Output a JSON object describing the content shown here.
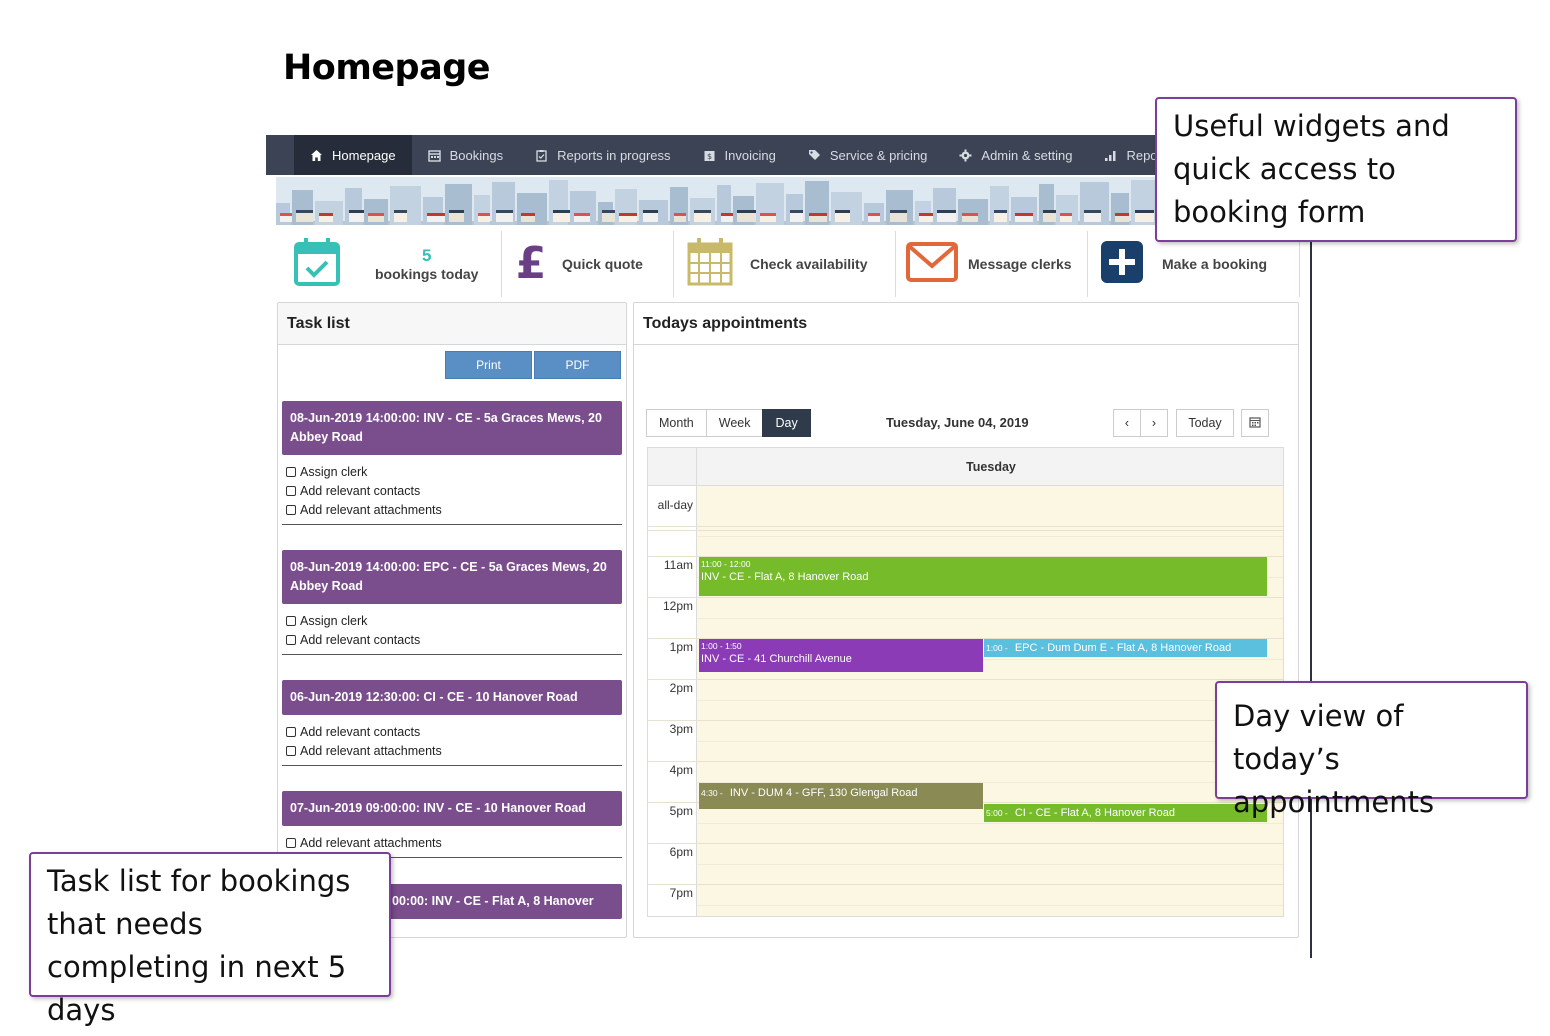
{
  "slide_title": "Homepage",
  "nav": {
    "items": [
      {
        "label": "Homepage",
        "icon": "home-icon",
        "active": true
      },
      {
        "label": "Bookings",
        "icon": "calendar-icon"
      },
      {
        "label": "Reports in progress",
        "icon": "clipboard-icon"
      },
      {
        "label": "Invoicing",
        "icon": "invoice-icon"
      },
      {
        "label": "Service & pricing",
        "icon": "tag-icon"
      },
      {
        "label": "Admin & setting",
        "icon": "gear-icon"
      },
      {
        "label": "Repo",
        "icon": "bar-chart-icon"
      }
    ]
  },
  "widgets": {
    "bookings_count": "5",
    "bookings_label": "bookings today",
    "quick_quote": "Quick quote",
    "check_availability": "Check availability",
    "message_clerks": "Message clerks",
    "make_booking": "Make a booking",
    "colors": {
      "teal": "#35c1b6",
      "purple": "#6a3f86",
      "khaki": "#c9b96a",
      "orange": "#e2683a",
      "navy": "#1b3f6b"
    }
  },
  "task_list": {
    "title": "Task list",
    "print_label": "Print",
    "pdf_label": "PDF",
    "tasks": [
      {
        "title": "08-Jun-2019 14:00:00: INV - CE - 5a Graces Mews, 20 Abbey Road",
        "checks": [
          "Assign clerk",
          "Add relevant contacts",
          "Add relevant attachments"
        ]
      },
      {
        "title": "08-Jun-2019 14:00:00: EPC - CE - 5a Graces Mews, 20 Abbey Road",
        "checks": [
          "Assign clerk",
          "Add relevant contacts"
        ]
      },
      {
        "title": "06-Jun-2019 12:30:00: CI - CE - 10 Hanover Road",
        "checks": [
          "Add relevant contacts",
          "Add relevant attachments"
        ]
      },
      {
        "title": "07-Jun-2019 09:00:00: INV - CE - 10 Hanover Road",
        "checks": [
          "Add relevant attachments"
        ]
      },
      {
        "title": "00:00: INV - CE - Flat A, 8 Hanover",
        "checks": []
      }
    ]
  },
  "appointments": {
    "title": "Todays appointments",
    "views": [
      "Month",
      "Week",
      "Day"
    ],
    "active_view": "Day",
    "date": "Tuesday, June 04, 2019",
    "prev": "‹",
    "next": "›",
    "today": "Today",
    "calendar_icon": "calendar-icon",
    "day_label": "Tuesday",
    "allday_label": "all-day",
    "hours": [
      "11am",
      "12pm",
      "1pm",
      "2pm",
      "3pm",
      "4pm",
      "5pm",
      "6pm",
      "7pm"
    ],
    "events": [
      {
        "time": "11:00 - 12:00",
        "title": "INV - CE - Flat A, 8 Hanover Road",
        "color": "#76bc2a"
      },
      {
        "time": "1:00 - 1:50",
        "title": "INV - CE - 41 Churchill Avenue",
        "color": "#8b3bb5"
      },
      {
        "time": "1:00 -",
        "title": "EPC - Dum Dum E - Flat A, 8 Hanover Road",
        "color": "#5bc0de"
      },
      {
        "time": "4:30 -",
        "title": "INV - DUM 4 - GFF, 130 Glengal Road",
        "color": "#8a8a55"
      },
      {
        "time": "5:00 -",
        "title": "CI - CE - Flat A, 8 Hanover Road",
        "color": "#76bc2a"
      }
    ]
  },
  "callouts": {
    "widgets": "Useful widgets and quick access to booking form",
    "dayview": "Day view of today’s appointments",
    "tasklist": "Task list for bookings that needs completing in next 5 days"
  }
}
